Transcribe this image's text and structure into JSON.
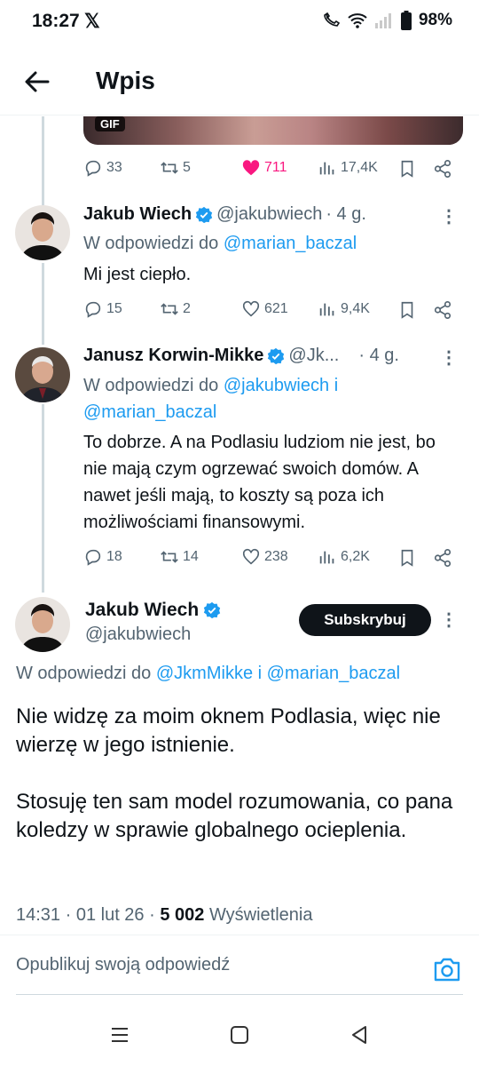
{
  "status": {
    "time": "18:27",
    "x_icon": "x-logo-icon",
    "battery": "98%"
  },
  "header": {
    "title": "Wpis"
  },
  "gif": {
    "badge": "GIF"
  },
  "parent_actions": {
    "replies": "33",
    "reposts": "5",
    "likes": "711",
    "views": "17,4K",
    "liked": true,
    "like_color": "#f91880"
  },
  "tweets": [
    {
      "name": "Jakub Wiech",
      "handle": "@jakubwiech",
      "time": "· 4 g.",
      "reply_prefix": "W odpowiedzi do",
      "mention1": "@marian_baczal",
      "text": "Mi jest ciepło.",
      "replies": "15",
      "reposts": "2",
      "likes": "621",
      "views": "9,4K"
    },
    {
      "name": "Janusz Korwin-Mikke",
      "handle": "@Jk...",
      "time": "· 4 g.",
      "reply_prefix": "W odpowiedzi do",
      "mention1": "@jakubwiech",
      "joiner": "i",
      "mention2": "@marian_baczal",
      "text": "To dobrze. A na Podlasiu ludziom nie jest, bo nie mają czym ogrzewać swoich domów. A nawet jeśli mają, to koszty są poza ich możliwościami finansowymi.",
      "replies": "18",
      "reposts": "14",
      "likes": "238",
      "views": "6,2K"
    }
  ],
  "main": {
    "name": "Jakub Wiech",
    "handle": "@jakubwiech",
    "subscribe": "Subskrybuj",
    "reply_prefix": "W odpowiedzi do",
    "mention1": "@JkmMikke",
    "joiner": "i",
    "mention2": "@marian_baczal",
    "para1": "Nie widzę za moim oknem Podlasia, więc nie wierzę w jego istnienie.",
    "para2": "Stosuję ten sam model rozumowania, co pana koledzy w sprawie globalnego ocieplenia.",
    "time": "14:31 · 01 lut 26 ·",
    "views_count": "5 002",
    "views_label": "Wyświetlenia"
  },
  "reply_box": {
    "placeholder": "Opublikuj swoją odpowiedź"
  },
  "colors": {
    "accent": "#1d9bf0",
    "muted": "#536471",
    "text": "#0f1419"
  }
}
